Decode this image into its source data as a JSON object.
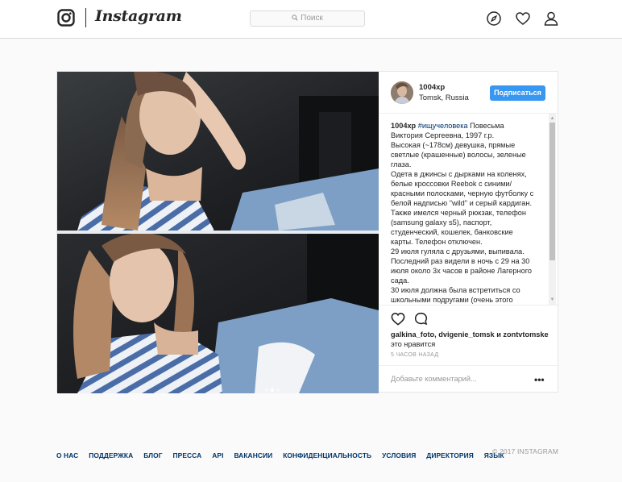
{
  "nav": {
    "brand": "Instagram",
    "search_placeholder": "Поиск",
    "icons": [
      "instagram-camera-icon",
      "explore-compass-icon",
      "heart-icon",
      "profile-user-icon"
    ]
  },
  "post": {
    "username": "1004xp",
    "location": "Tomsk, Russia",
    "follow_label": "Подписаться",
    "caption_username": "1004xp",
    "caption_tag": "#ищучеловека",
    "caption_lines": [
      " Повесьма",
      "Виктория Сергеевна, 1997 г.р.",
      "Высокая (~178см) девушка, прямые",
      "светлые (крашенные) волосы, зеленые",
      "глаза.",
      "Одета в джинсы с дырками на коленях,",
      "белые кроссовки Reebok с синими/",
      "красными полосками, черную футболку с",
      "белой надписью \"wild\" и серый кардиган.",
      "Также имелся черный рюкзак, телефон",
      "(samsung galaxy s5), паспорт,",
      "студенческий, кошелек, банковские",
      "карты. Телефон отключен.",
      "29 июля гуляла с друзьями, выпивала.",
      "Последний раз видели в ночь с 29 на 30",
      "июля около 3х часов в районе Лагерного",
      "сада.",
      "30 июля должна была встретиться со",
      "школьными подругами (очень этого"
    ],
    "likes_text": "galkina_foto, dvigenie_tomsk и zontvtomske",
    "likes_suffix": "это нравится",
    "time_ago": "5 ЧАСОВ НАЗАД",
    "comment_placeholder": "Добавьте комментарий...",
    "more_label": "•••",
    "carousel": {
      "total": 3,
      "active_index": 1
    }
  },
  "footer": {
    "links": [
      "О НАС",
      "ПОДДЕРЖКА",
      "БЛОГ",
      "ПРЕССА",
      "API",
      "ВАКАНСИИ",
      "КОНФИДЕНЦИАЛЬНОСТЬ",
      "УСЛОВИЯ",
      "ДИРЕКТОРИЯ",
      "ЯЗЫК"
    ],
    "copyright": "© 2017 INSTAGRAM"
  },
  "colors": {
    "accent": "#3897f0",
    "link": "#003569",
    "page_bg": "#fafafa",
    "border": "#dbdbdb"
  }
}
